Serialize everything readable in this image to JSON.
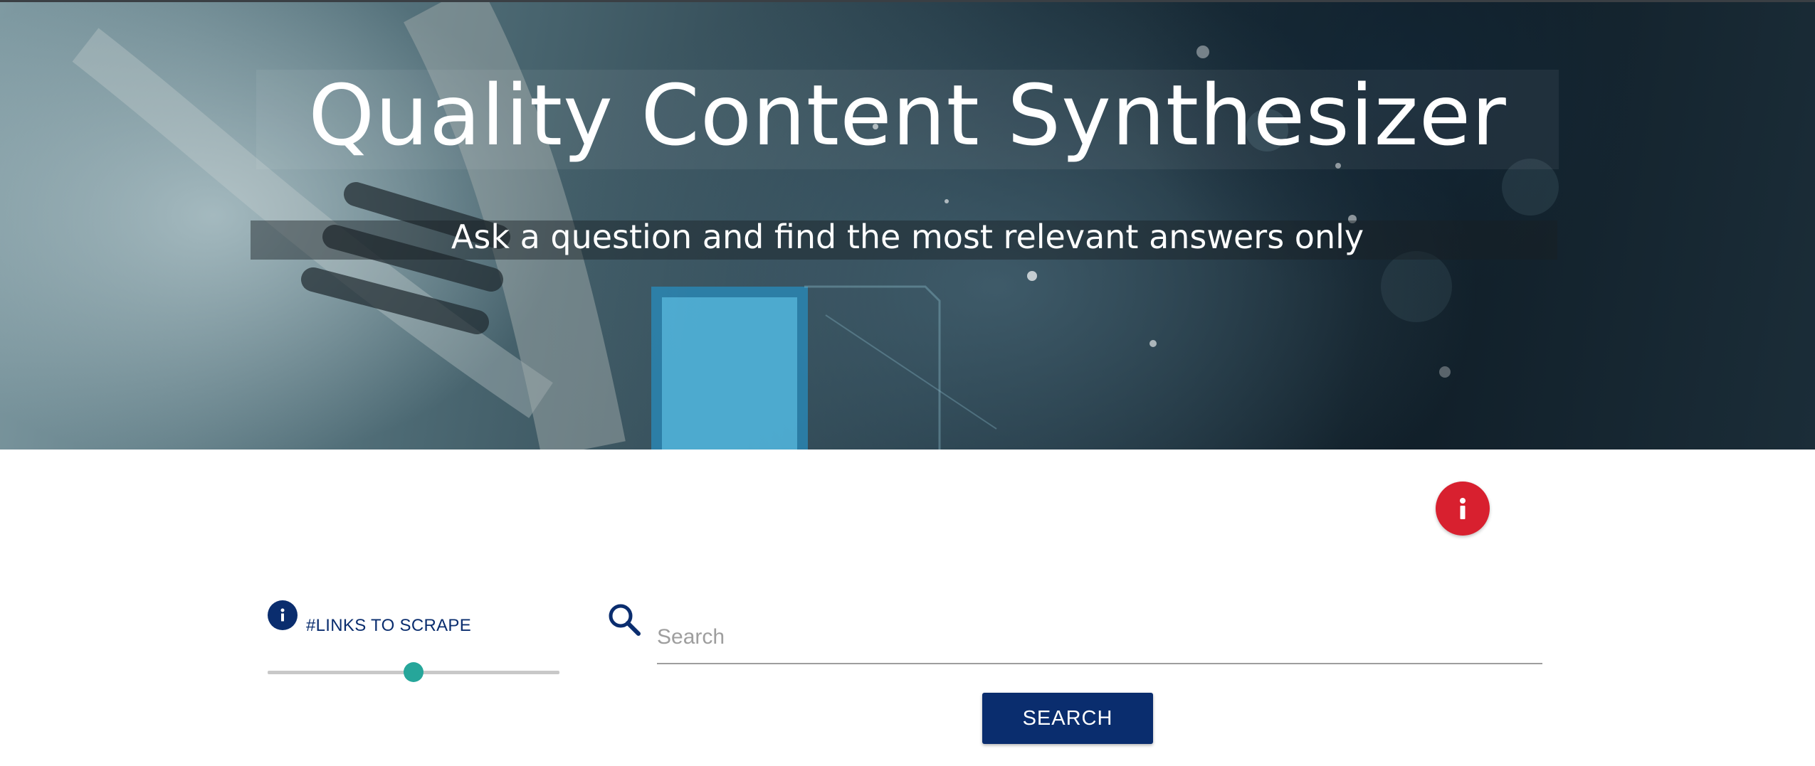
{
  "hero": {
    "title": "Quality Content Synthesizer",
    "subtitle": "Ask a question and find the most relevant answers only"
  },
  "info_button": {
    "icon": "info-icon",
    "glyph": "i",
    "color": "#d8202f"
  },
  "links_control": {
    "info_icon": "info-icon",
    "info_glyph": "i",
    "label": "#LINKS TO SCRAPE",
    "slider_value_fraction": 0.5,
    "thumb_color": "#26a69a"
  },
  "search": {
    "icon": "search-icon",
    "placeholder": "Search",
    "value": "",
    "button_label": "SEARCH",
    "button_color": "#0a2d6e"
  }
}
